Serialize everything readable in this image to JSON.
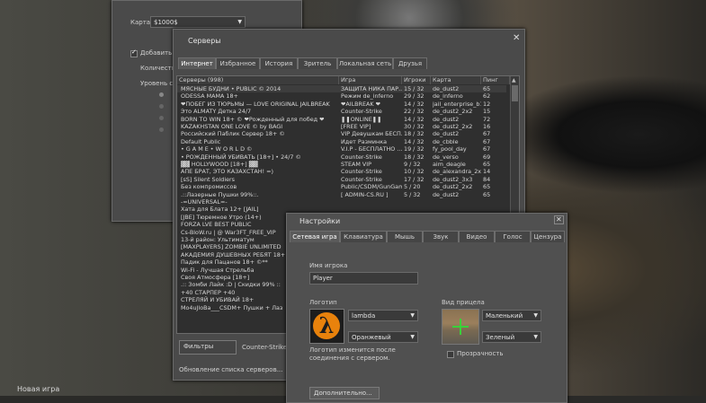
{
  "background_window": {
    "map_label": "Карта",
    "map_value": "$1000$",
    "add_bots_label": "Добавить",
    "count_label": "Количеств",
    "level_label": "Уровень с"
  },
  "servers": {
    "title": "Серверы",
    "tabs": [
      "Интернет",
      "Избранное",
      "История",
      "Зритель",
      "Локальная сеть",
      "Друзья"
    ],
    "active_tab": "Интернет",
    "columns": {
      "name": "Серверы (998)",
      "game": "Игра",
      "players": "Игроки",
      "map": "Карта",
      "ping": "Пинг"
    },
    "rows": [
      {
        "name": "МЯСНЫЕ БУДНИ • PUBLIC © 2014",
        "game": "ЗАЩИТА НИКА ПАР...",
        "players": "15 / 32",
        "map": "de_dust2",
        "ping": "65"
      },
      {
        "name": "ODESSA MAMA 18+",
        "game": "Режим de_inferno",
        "players": "29 / 32",
        "map": "de_inferno",
        "ping": "62"
      },
      {
        "name": "❤ПОБЕГ ИЗ ТЮРЬМЫ — LOVE ORIGINAL JAILBREAK",
        "game": "❤AILBREAK ❤",
        "players": "14 / 32",
        "map": "jail_enterprise_b1",
        "ping": "12"
      },
      {
        "name": "Это ALMATY Детка 24/7",
        "game": "Counter-Strike",
        "players": "22 / 32",
        "map": "de_dust2_2x2",
        "ping": "15"
      },
      {
        "name": "BORN TO WIN 18+ © ❤Рожденный для побед ❤",
        "game": "❚❚ONLINE❚❚",
        "players": "14 / 32",
        "map": "de_dust2",
        "ping": "72"
      },
      {
        "name": "KAZAKHSTAN ONE LOVE © by BAGI",
        "game": "[FREE VIP]",
        "players": "30 / 32",
        "map": "de_dust2_2x2",
        "ping": "16"
      },
      {
        "name": "Российский Паблик Сервер 18+ ©",
        "game": "VIP Девушкам БЕСП...",
        "players": "18 / 32",
        "map": "de_dust2",
        "ping": "67"
      },
      {
        "name": "Default Public",
        "game": "Идет Разминка",
        "players": "14 / 32",
        "map": "de_cbble",
        "ping": "67"
      },
      {
        "name": "• G A M E • W O R L D ©",
        "game": "V.I.P - БЕСПЛАТНО ...",
        "players": "19 / 32",
        "map": "fy_pool_day",
        "ping": "67"
      },
      {
        "name": "• РОЖДЕННЫЙ УБИВАТЬ [18+] • 24/7 ©",
        "game": "Counter-Strike",
        "players": "18 / 32",
        "map": "de_verso",
        "ping": "69"
      },
      {
        "name": "▓▓ HOLLYWOOD [18+] ▓▓",
        "game": "STEAM VIP",
        "players": "9 / 32",
        "map": "aim_deagle",
        "ping": "65"
      },
      {
        "name": "АПЕ БРАТ, ЭТО КАЗАХСТАН! =)",
        "game": "Counter-Strike",
        "players": "10 / 32",
        "map": "de_alexandra_2x2",
        "ping": "14"
      },
      {
        "name": "[sS] Silent Soldiers",
        "game": "Counter-Strike",
        "players": "17 / 32",
        "map": "de_dust2_3x3",
        "ping": "84"
      },
      {
        "name": "Без компромиссов",
        "game": "Public/CSDM/GunGame",
        "players": "5 / 20",
        "map": "de_dust2_2x2",
        "ping": "65"
      },
      {
        "name": ".::Лазерные Пушки 99%::.",
        "game": "[ ADMIN-CS.RU ]",
        "players": "5 / 32",
        "map": "de_dust2",
        "ping": "65"
      },
      {
        "name": "-=UNIVERSAL=-",
        "game": "",
        "players": "",
        "map": "",
        "ping": ""
      },
      {
        "name": "Хата для Блата 12+ [JAIL]",
        "game": "",
        "players": "",
        "map": "",
        "ping": ""
      },
      {
        "name": "[JBE] Тюремное Утро (14+)",
        "game": "",
        "players": "",
        "map": "",
        "ping": ""
      },
      {
        "name": "FORZA LVE BEST PUBLIC",
        "game": "",
        "players": "",
        "map": "",
        "ping": ""
      },
      {
        "name": "Cs-BloW.ru | @ War3FT_FREE_VIP",
        "game": "",
        "players": "",
        "map": "",
        "ping": ""
      },
      {
        "name": "13-й район: Ультиматум",
        "game": "",
        "players": "",
        "map": "",
        "ping": ""
      },
      {
        "name": "[MAXPLAYERS] ZOMBIE UNLIMITED",
        "game": "",
        "players": "",
        "map": "",
        "ping": ""
      },
      {
        "name": "АКАДЕМИЯ ДУШЕВНЫХ РЕБЯТ 18+",
        "game": "",
        "players": "",
        "map": "",
        "ping": ""
      },
      {
        "name": "Падик для Пацанов 18+ ©**",
        "game": "",
        "players": "",
        "map": "",
        "ping": ""
      },
      {
        "name": "Wi-Fi - Лучшая Стрельба",
        "game": "",
        "players": "",
        "map": "",
        "ping": ""
      },
      {
        "name": "Своя Атмосфера [18+]",
        "game": "",
        "players": "",
        "map": "",
        "ping": ""
      },
      {
        "name": ".:: Зомби Лайк :D | Скидки 99% ::",
        "game": "",
        "players": "",
        "map": "",
        "ping": ""
      },
      {
        "name": "+40 СТАРПЕР +40",
        "game": "",
        "players": "",
        "map": "",
        "ping": ""
      },
      {
        "name": "СТРЕЛЯЙ И УБИВАЙ 18+",
        "game": "",
        "players": "",
        "map": "",
        "ping": ""
      },
      {
        "name": "Mo4uJloBa___CSDM+ Пушки + Лаз",
        "game": "",
        "players": "",
        "map": "",
        "ping": ""
      }
    ],
    "filters_label": "Фильтры",
    "filter_game": "Counter-Strike",
    "status": "Обновление списка серверов..."
  },
  "settings": {
    "title": "Настройки",
    "tabs": [
      "Сетевая игра",
      "Клавиатура",
      "Мышь",
      "Звук",
      "Видео",
      "Голос",
      "Цензура"
    ],
    "active_tab": "Сетевая игра",
    "player_name_label": "Имя игрока",
    "player_name_value": "Player",
    "logo_label": "Логотип",
    "logo_value": "lambda",
    "logo_color": "Оранжевый",
    "logo_note": "Логотип изменится после соединения с сервером.",
    "crosshair_label": "Вид прицела",
    "crosshair_size": "Маленький",
    "crosshair_color": "Зеленый",
    "transparency_label": "Прозрачность",
    "advanced_button": "Дополнительно...",
    "accent_color": "#e8820c"
  },
  "footer": {
    "new_game": "Новая игра"
  }
}
